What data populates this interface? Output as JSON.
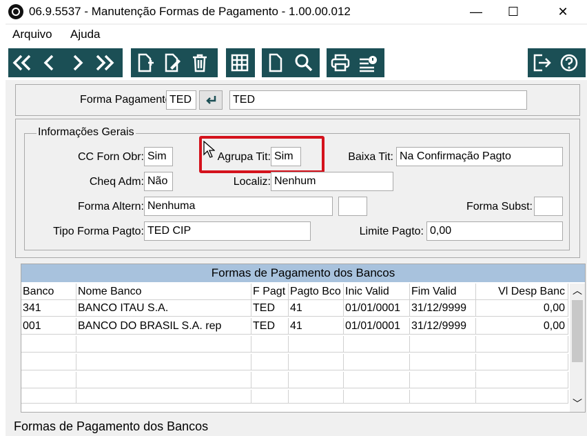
{
  "window": {
    "title": "06.9.5537 - Manutenção Formas de Pagamento - 1.00.00.012",
    "minimize": "—",
    "maximize": "☐",
    "close": "✕"
  },
  "menu": {
    "items": [
      {
        "label": "Arquivo"
      },
      {
        "label": "Ajuda"
      }
    ]
  },
  "toolbar": {
    "icons": [
      "first-record-icon",
      "previous-record-icon",
      "next-record-icon",
      "last-record-icon",
      "new-record-icon",
      "edit-record-icon",
      "delete-record-icon",
      "grid-view-icon",
      "document-icon",
      "search-icon",
      "print-icon",
      "report-icon",
      "exit-icon",
      "help-icon"
    ]
  },
  "forma": {
    "label": "Forma Pagamento:",
    "code": "TED",
    "description": "TED"
  },
  "info": {
    "legend": "Informações Gerais",
    "cc_forn_obr_label": "CC Forn Obr:",
    "cc_forn_obr_value": "Sim",
    "agrupa_tit_label": "Agrupa Tit:",
    "agrupa_tit_value": "Sim",
    "baixa_tit_label": "Baixa Tit:",
    "baixa_tit_value": "Na Confirmação Pagto",
    "cheq_adm_label": "Cheq Adm:",
    "cheq_adm_value": "Não",
    "localiz_label": "Localiz:",
    "localiz_value": "Nenhum",
    "forma_altern_label": "Forma Altern:",
    "forma_altern_value": "Nenhuma",
    "forma_altern_extra": "",
    "forma_subst_label": "Forma Subst:",
    "forma_subst_value": "",
    "tipo_forma_label": "Tipo Forma Pagto:",
    "tipo_forma_value": "TED CIP",
    "limite_label": "Limite Pagto:",
    "limite_value": "0,00"
  },
  "grid": {
    "title": "Formas de Pagamento dos Bancos",
    "columns": [
      "Banco",
      "Nome Banco",
      "F Pagt",
      "Pagto Bco",
      "Inic Valid",
      "Fim Valid",
      "Vl Desp Banc"
    ],
    "rows": [
      [
        "341",
        "BANCO ITAU S.A.",
        "TED",
        "41",
        "01/01/0001",
        "31/12/9999",
        "0,00"
      ],
      [
        "001",
        "BANCO DO BRASIL S.A. rep",
        "TED",
        "41",
        "01/01/0001",
        "31/12/9999",
        "0,00"
      ]
    ],
    "scroll_up": "︿",
    "scroll_down": "﹀"
  },
  "status": {
    "text": "Formas de Pagamento dos Bancos"
  },
  "colors": {
    "toolbar": "#1b4f55",
    "highlight": "#d4121c",
    "grid_header": "#a8c2dd"
  }
}
